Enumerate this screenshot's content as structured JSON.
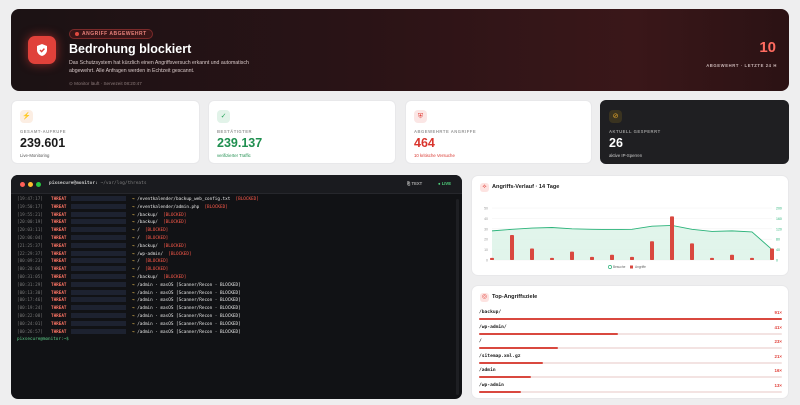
{
  "hero": {
    "chip": "ANGRIFF ABGEWEHRT",
    "title": "Bedrohung blockiert",
    "desc": "Das Schutzsystem hat kürzlich einen Angriffsversuch erkannt und automatisch abgewehrt. Alle Anfragen werden in Echtzeit gescannt.",
    "meta": "⊙ Monitor läuft · Servezeit 08:20:47",
    "count": "10",
    "count_label": "ABGEWEHRT · LETZTE 24 H"
  },
  "cards": [
    {
      "icon": "activity-icon",
      "label": "GESAMT-AUFRUFE",
      "value": "239.601",
      "sub": "Live-Monitoring",
      "icon_color": "#e57c2a",
      "value_color": "#1a1a1a"
    },
    {
      "icon": "user-check-icon",
      "label": "BESTÄTIGTER",
      "value": "239.137",
      "sub": "verifizierter Traffic",
      "icon_color": "#27a35a",
      "value_color": "#1f8f4f"
    },
    {
      "icon": "shield-icon",
      "label": "ABGEWEHRTE ANGRIFFE",
      "value": "464",
      "sub": "10 kritische Versuche",
      "icon_color": "#e0413a",
      "value_color": "#d9342c"
    },
    {
      "icon": "ban-icon",
      "label": "AKTUELL GESPERRT",
      "value": "26",
      "sub": "aktive IP-Sperren",
      "icon_color": "#e8a82b",
      "value_color": "#ffffff"
    }
  ],
  "terminal": {
    "user": "pixsecure@monitor:",
    "path": " ~/var/log/threats",
    "tag_text": "TEXT",
    "tag_live": "LIVE",
    "prompt": "pixsecure@monitor:~$",
    "lines": [
      {
        "ts": "[19:47:17]",
        "path": "/eventkalender/backup_web_config.txt",
        "status": "[BLOCKED]"
      },
      {
        "ts": "[19:50:17]",
        "path": "/eventkalender/admin.php",
        "status": "[BLOCKED]"
      },
      {
        "ts": "[19:55:21]",
        "path": "/backup/",
        "status": "[BLOCKED]"
      },
      {
        "ts": "[20:00:19]",
        "path": "/backup/",
        "status": "[BLOCKED]"
      },
      {
        "ts": "[20:03:11]",
        "path": "/",
        "status": "[BLOCKED]"
      },
      {
        "ts": "[20:06:04]",
        "path": "/",
        "status": "[BLOCKED]"
      },
      {
        "ts": "[21:25:37]",
        "path": "/backup/",
        "status": "[BLOCKED]"
      },
      {
        "ts": "[22:29:37]",
        "path": "/wp-admin/",
        "status": "[BLOCKED]"
      },
      {
        "ts": "[00:09:23]",
        "path": "/",
        "status": "[BLOCKED]"
      },
      {
        "ts": "[00:20:06]",
        "path": "/",
        "status": "[BLOCKED]"
      },
      {
        "ts": "[00:31:05]",
        "path": "/backup/",
        "status": "[BLOCKED]"
      },
      {
        "ts": "[00:31:29]",
        "path": "/admin · masOS [Scanner/Recon · BLOCKED]",
        "status": ""
      },
      {
        "ts": "[00:13:30]",
        "path": "/admin · masOS [Scanner/Recon · BLOCKED]",
        "status": ""
      },
      {
        "ts": "[00:17:46]",
        "path": "/admin · masOS [Scanner/Recon · BLOCKED]",
        "status": ""
      },
      {
        "ts": "[00:19:24]",
        "path": "/admin · masOS [Scanner/Recon · BLOCKED]",
        "status": ""
      },
      {
        "ts": "[00:22:08]",
        "path": "/admin · masOS [Scanner/Recon · BLOCKED]",
        "status": ""
      },
      {
        "ts": "[00:24:01]",
        "path": "/admin · masOS [Scanner/Recon · BLOCKED]",
        "status": ""
      },
      {
        "ts": "[00:26:57]",
        "path": "/admin · masOS [Scanner/Recon · BLOCKED]",
        "status": ""
      }
    ],
    "threat_label": "THREAT"
  },
  "history": {
    "title": "Angriffs-Verlauf · 14 Tage",
    "legend": [
      "Besuche",
      "Angriffe"
    ]
  },
  "chart_data": {
    "type": "bar",
    "title": "Angriffs-Verlauf · 14 Tage",
    "series": [
      {
        "name": "Angriffe",
        "values": [
          2,
          24,
          11,
          2,
          8,
          3,
          5,
          3,
          18,
          42,
          16,
          2,
          5,
          2,
          11
        ]
      },
      {
        "name": "Besuche",
        "values": [
          112,
          118,
          123,
          125,
          120,
          118,
          117,
          118,
          130,
          133,
          118,
          110,
          112,
          108,
          40
        ]
      }
    ],
    "ylim_left": [
      0,
      50
    ],
    "ylim_right": [
      0,
      200
    ]
  },
  "targets": {
    "title": "Top-Angriffsziele",
    "items": [
      {
        "path": "/backup/",
        "count": "91×",
        "frac": 1.0
      },
      {
        "path": "/wp-admin/",
        "count": "41×",
        "frac": 0.46
      },
      {
        "path": "/",
        "count": "23×",
        "frac": 0.26
      },
      {
        "path": "/sitemap.xml.gz",
        "count": "21×",
        "frac": 0.21
      },
      {
        "path": "/admin",
        "count": "16×",
        "frac": 0.17
      },
      {
        "path": "/wp-admin",
        "count": "13×",
        "frac": 0.14
      }
    ]
  }
}
